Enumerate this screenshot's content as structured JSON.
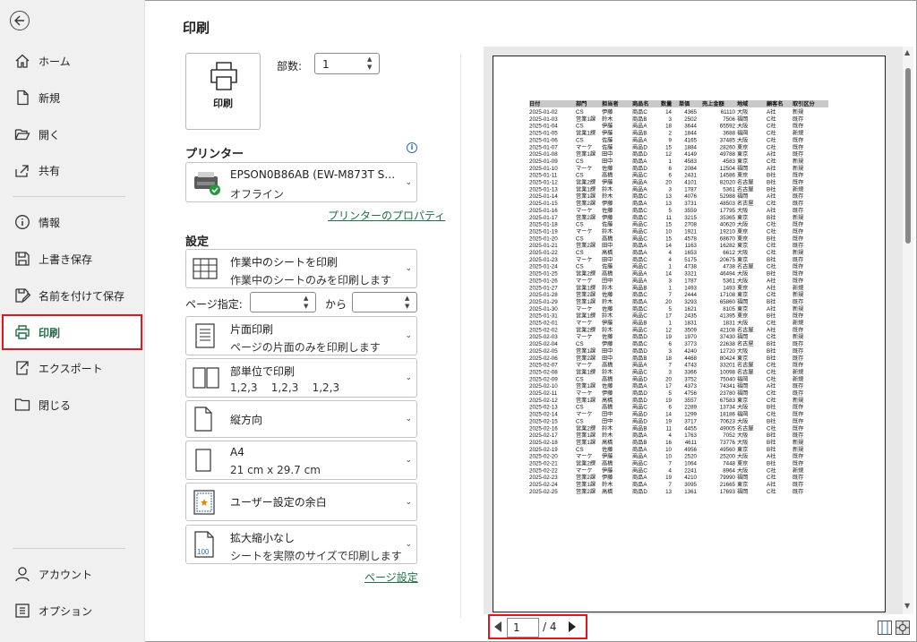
{
  "nav": {
    "items": [
      {
        "key": "home",
        "label": "ホーム",
        "icon": "home-icon"
      },
      {
        "key": "new",
        "label": "新規",
        "icon": "new-document-icon"
      },
      {
        "key": "open",
        "label": "開く",
        "icon": "folder-open-icon"
      },
      {
        "key": "share",
        "label": "共有",
        "icon": "share-icon"
      },
      {
        "key": "info",
        "label": "情報",
        "icon": "info-icon"
      },
      {
        "key": "save",
        "label": "上書き保存",
        "icon": "save-icon"
      },
      {
        "key": "saveas",
        "label": "名前を付けて保存",
        "icon": "save-as-icon"
      },
      {
        "key": "print",
        "label": "印刷",
        "icon": "printer-icon",
        "active": true
      },
      {
        "key": "export",
        "label": "エクスポート",
        "icon": "export-icon"
      },
      {
        "key": "close",
        "label": "閉じる",
        "icon": "close-folder-icon"
      },
      {
        "key": "account",
        "label": "アカウント",
        "icon": "account-icon"
      },
      {
        "key": "options",
        "label": "オプション",
        "icon": "options-icon"
      }
    ]
  },
  "print": {
    "title": "印刷",
    "print_button": "印刷",
    "copies_label": "部数:",
    "copies_value": "1",
    "printer_heading": "プリンター",
    "printer_name": "EPSON0B86AB (EW-M873T S…",
    "printer_status": "オフライン",
    "printer_properties": "プリンターのプロパティ",
    "settings_heading": "設定",
    "what_to_print": {
      "title": "作業中のシートを印刷",
      "sub": "作業中のシートのみを印刷します"
    },
    "pages_label": "ページ指定:",
    "pages_from": "",
    "to_label": "から",
    "pages_to": "",
    "sides": {
      "title": "片面印刷",
      "sub": "ページの片面のみを印刷します"
    },
    "collate": {
      "title": "部単位で印刷",
      "sub": "1,2,3    1,2,3    1,2,3"
    },
    "orientation": {
      "title": "縦方向"
    },
    "paper": {
      "title": "A4",
      "sub": "21 cm x 29.7 cm"
    },
    "margins": {
      "title": "ユーザー設定の余白"
    },
    "scaling": {
      "title": "拡大縮小なし",
      "sub": "シートを実際のサイズで印刷します"
    },
    "page_setup": "ページ設定"
  },
  "preview": {
    "current_page": "1",
    "total_pages": "/ 4",
    "table": {
      "headers": [
        "日付",
        "部門",
        "担当者",
        "商品名",
        "数量",
        "単価",
        "売上金額",
        "地域",
        "顧客名",
        "取引区分"
      ],
      "rows": [
        [
          "2025-01-02",
          "CS",
          "伊藤",
          "商品C",
          "14",
          "4365",
          "61110",
          "大阪",
          "A社",
          "新規"
        ],
        [
          "2025-01-03",
          "営業1課",
          "鈴木",
          "商品B",
          "3",
          "2502",
          "7506",
          "福岡",
          "C社",
          "既存"
        ],
        [
          "2025-01-04",
          "CS",
          "伊藤",
          "商品A",
          "18",
          "3644",
          "65592",
          "大阪",
          "C社",
          "既存"
        ],
        [
          "2025-01-05",
          "営業1課",
          "伊藤",
          "商品B",
          "2",
          "1844",
          "3688",
          "福岡",
          "C社",
          "新規"
        ],
        [
          "2025-01-06",
          "CS",
          "佐藤",
          "商品A",
          "9",
          "4165",
          "37485",
          "大阪",
          "C社",
          "既存"
        ],
        [
          "2025-01-07",
          "マーケ",
          "佐藤",
          "商品D",
          "15",
          "1884",
          "28260",
          "東京",
          "C社",
          "既存"
        ],
        [
          "2025-01-08",
          "営業1課",
          "田中",
          "商品D",
          "12",
          "4149",
          "49788",
          "東京",
          "A社",
          "既存"
        ],
        [
          "2025-01-09",
          "CS",
          "田中",
          "商品A",
          "1",
          "4583",
          "4583",
          "東京",
          "C社",
          "新規"
        ],
        [
          "2025-01-10",
          "マーケ",
          "佐藤",
          "商品D",
          "6",
          "2084",
          "12504",
          "福岡",
          "A社",
          "新規"
        ],
        [
          "2025-01-11",
          "CS",
          "高橋",
          "商品C",
          "6",
          "2431",
          "14586",
          "東京",
          "B社",
          "既存"
        ],
        [
          "2025-01-12",
          "営業2課",
          "伊藤",
          "商品A",
          "20",
          "4101",
          "82020",
          "名古屋",
          "B社",
          "既存"
        ],
        [
          "2025-01-13",
          "営業1課",
          "鈴木",
          "商品A",
          "3",
          "1787",
          "5361",
          "名古屋",
          "B社",
          "新規"
        ],
        [
          "2025-01-14",
          "営業1課",
          "鈴木",
          "商品C",
          "13",
          "4076",
          "52988",
          "福岡",
          "A社",
          "既存"
        ],
        [
          "2025-01-15",
          "営業2課",
          "伊藤",
          "商品A",
          "13",
          "3731",
          "48503",
          "名古屋",
          "C社",
          "既存"
        ],
        [
          "2025-01-16",
          "マーケ",
          "佐藤",
          "商品C",
          "5",
          "3559",
          "17795",
          "大阪",
          "A社",
          "既存"
        ],
        [
          "2025-01-17",
          "営業2課",
          "伊藤",
          "商品C",
          "11",
          "3215",
          "35365",
          "東京",
          "B社",
          "新規"
        ],
        [
          "2025-01-18",
          "CS",
          "佐藤",
          "商品C",
          "15",
          "2708",
          "40620",
          "大阪",
          "C社",
          "既存"
        ],
        [
          "2025-01-19",
          "マーケ",
          "鈴木",
          "商品C",
          "10",
          "1921",
          "19210",
          "東京",
          "C社",
          "既存"
        ],
        [
          "2025-01-20",
          "CS",
          "高橋",
          "商品C",
          "15",
          "4578",
          "68670",
          "東京",
          "B社",
          "既存"
        ],
        [
          "2025-01-21",
          "営業2課",
          "田中",
          "商品A",
          "14",
          "1163",
          "16282",
          "東京",
          "C社",
          "既存"
        ],
        [
          "2025-01-22",
          "CS",
          "高橋",
          "商品A",
          "4",
          "1653",
          "6612",
          "大阪",
          "C社",
          "新規"
        ],
        [
          "2025-01-23",
          "マーケ",
          "田中",
          "商品C",
          "4",
          "5175",
          "20675",
          "東京",
          "B社",
          "既存"
        ],
        [
          "2025-01-24",
          "CS",
          "佐藤",
          "商品C",
          "1",
          "4738",
          "4738",
          "名古屋",
          "C社",
          "既存"
        ],
        [
          "2025-01-25",
          "営業2課",
          "高橋",
          "商品A",
          "14",
          "3321",
          "46494",
          "大阪",
          "B社",
          "既存"
        ],
        [
          "2025-01-26",
          "マーケ",
          "田中",
          "商品A",
          "3",
          "1787",
          "5361",
          "大阪",
          "A社",
          "既存"
        ],
        [
          "2025-01-27",
          "営業1課",
          "鈴木",
          "商品B",
          "1",
          "1493",
          "1493",
          "東京",
          "A社",
          "新規"
        ],
        [
          "2025-01-28",
          "営業2課",
          "佐藤",
          "商品C",
          "7",
          "2444",
          "17108",
          "東京",
          "C社",
          "新規"
        ],
        [
          "2025-01-29",
          "営業1課",
          "鈴木",
          "商品A",
          "20",
          "3293",
          "65860",
          "福岡",
          "B社",
          "既存"
        ],
        [
          "2025-01-30",
          "マーケ",
          "佐藤",
          "商品C",
          "5",
          "1621",
          "8105",
          "東京",
          "A社",
          "新規"
        ],
        [
          "2025-01-31",
          "営業1課",
          "鈴木",
          "商品C",
          "17",
          "2435",
          "41395",
          "東京",
          "B社",
          "既存"
        ],
        [
          "2025-02-01",
          "マーケ",
          "伊藤",
          "商品B",
          "1",
          "1831",
          "1831",
          "大阪",
          "C社",
          "新規"
        ],
        [
          "2025-02-02",
          "営業2課",
          "鈴木",
          "商品C",
          "12",
          "3509",
          "42108",
          "名古屋",
          "A社",
          "既存"
        ],
        [
          "2025-02-03",
          "マーケ",
          "佐藤",
          "商品D",
          "19",
          "1970",
          "37430",
          "福岡",
          "C社",
          "新規"
        ],
        [
          "2025-02-04",
          "CS",
          "伊藤",
          "商品C",
          "6",
          "3773",
          "22638",
          "名古屋",
          "B社",
          "既存"
        ],
        [
          "2025-02-05",
          "営業1課",
          "田中",
          "商品D",
          "3",
          "4240",
          "12720",
          "大阪",
          "B社",
          "既存"
        ],
        [
          "2025-02-06",
          "営業2課",
          "田中",
          "商品B",
          "18",
          "4468",
          "80424",
          "東京",
          "B社",
          "既存"
        ],
        [
          "2025-02-07",
          "マーケ",
          "高橋",
          "商品A",
          "7",
          "4743",
          "33201",
          "名古屋",
          "C社",
          "既存"
        ],
        [
          "2025-02-08",
          "営業1課",
          "鈴木",
          "商品C",
          "3",
          "3366",
          "10098",
          "名古屋",
          "C社",
          "新規"
        ],
        [
          "2025-02-09",
          "CS",
          "高橋",
          "商品D",
          "20",
          "3752",
          "75040",
          "福岡",
          "C社",
          "新規"
        ],
        [
          "2025-02-10",
          "営業1課",
          "佐藤",
          "商品A",
          "17",
          "4373",
          "74341",
          "福岡",
          "A社",
          "既存"
        ],
        [
          "2025-02-11",
          "マーケ",
          "伊藤",
          "商品D",
          "5",
          "4756",
          "23780",
          "福岡",
          "C社",
          "既存"
        ],
        [
          "2025-02-12",
          "営業1課",
          "高橋",
          "商品D",
          "19",
          "3557",
          "67583",
          "東京",
          "C社",
          "新規"
        ],
        [
          "2025-02-13",
          "CS",
          "高橋",
          "商品C",
          "6",
          "2289",
          "13734",
          "大阪",
          "B社",
          "既存"
        ],
        [
          "2025-02-14",
          "マーケ",
          "田中",
          "商品D",
          "14",
          "1299",
          "18186",
          "福岡",
          "C社",
          "既存"
        ],
        [
          "2025-02-15",
          "CS",
          "田中",
          "商品D",
          "19",
          "3717",
          "70623",
          "大阪",
          "B社",
          "既存"
        ],
        [
          "2025-02-16",
          "営業2課",
          "鈴木",
          "商品B",
          "11",
          "4455",
          "49005",
          "名古屋",
          "C社",
          "既存"
        ],
        [
          "2025-02-17",
          "営業1課",
          "鈴木",
          "商品A",
          "4",
          "1763",
          "7052",
          "大阪",
          "B社",
          "既存"
        ],
        [
          "2025-02-18",
          "営業1課",
          "高橋",
          "商品B",
          "16",
          "4611",
          "73776",
          "大阪",
          "B社",
          "新規"
        ],
        [
          "2025-02-19",
          "CS",
          "佐藤",
          "商品A",
          "10",
          "4956",
          "49560",
          "東京",
          "B社",
          "新規"
        ],
        [
          "2025-02-20",
          "マーケ",
          "伊藤",
          "商品A",
          "10",
          "2520",
          "25200",
          "大阪",
          "A社",
          "既存"
        ],
        [
          "2025-02-21",
          "営業2課",
          "高橋",
          "商品C",
          "7",
          "1064",
          "7448",
          "東京",
          "B社",
          "既存"
        ],
        [
          "2025-02-22",
          "マーケ",
          "伊藤",
          "商品C",
          "4",
          "2241",
          "8964",
          "大阪",
          "C社",
          "新規"
        ],
        [
          "2025-02-23",
          "営業2課",
          "伊藤",
          "商品A",
          "19",
          "4210",
          "79990",
          "福岡",
          "C社",
          "既存"
        ],
        [
          "2025-02-24",
          "営業1課",
          "鈴木",
          "商品A",
          "7",
          "3095",
          "21665",
          "東京",
          "A社",
          "既存"
        ],
        [
          "2025-02-25",
          "営業2課",
          "高橋",
          "商品D",
          "13",
          "1361",
          "17693",
          "福岡",
          "C社",
          "既存"
        ]
      ]
    }
  }
}
